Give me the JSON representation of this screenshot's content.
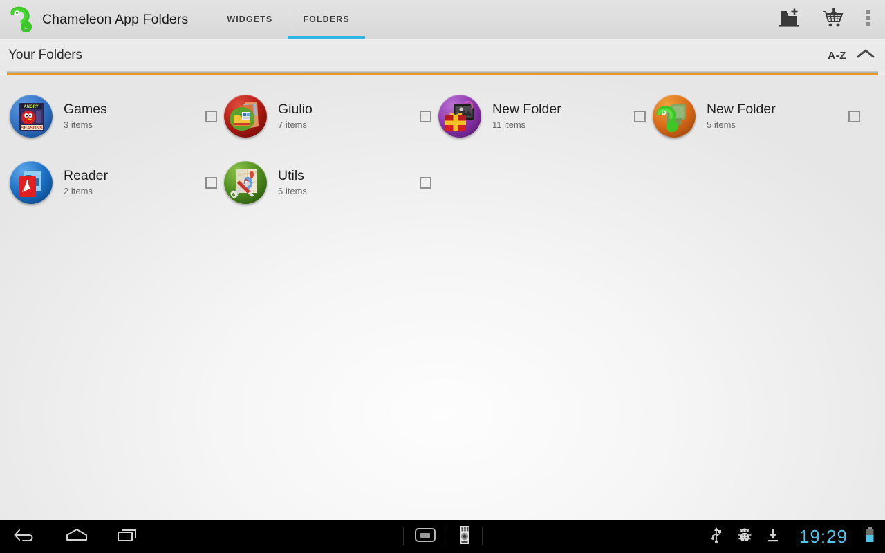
{
  "actionbar": {
    "logo_icon": "chameleon-logo-icon",
    "app_title": "Chameleon App Folders",
    "tabs": [
      {
        "label": "WIDGETS",
        "active": false
      },
      {
        "label": "FOLDERS",
        "active": true
      }
    ],
    "actions": [
      {
        "name": "new-folder-icon",
        "label": "New Folder"
      },
      {
        "name": "shopping-cart-download-icon",
        "label": "Get more"
      },
      {
        "name": "overflow-menu-icon",
        "label": "More options"
      }
    ],
    "accent_color": "#33b5e5"
  },
  "section": {
    "title": "Your Folders",
    "sort_label": "A-Z",
    "collapse_icon": "chevron-up-icon",
    "divider_color": "#e8871a"
  },
  "folders": [
    {
      "name": "Games",
      "count": "3 items",
      "icon": "angry-birds-seasons-icon",
      "bg": "#2f6fc0",
      "checked": false
    },
    {
      "name": "Giulio",
      "count": "7 items",
      "icon": "red-folder-stack-icon",
      "bg": "#b01a14",
      "checked": false
    },
    {
      "name": "New Folder",
      "count": "11 items",
      "icon": "purple-gift-box-icon",
      "bg": "#8b36ab",
      "checked": false
    },
    {
      "name": "New Folder",
      "count": "5 items",
      "icon": "chameleon-orange-icon",
      "bg": "#d96a18",
      "checked": false
    },
    {
      "name": "Reader",
      "count": "2 items",
      "icon": "adobe-reader-icon",
      "bg": "#1b6fc4",
      "checked": false
    },
    {
      "name": "Utils",
      "count": "6 items",
      "icon": "tools-map-icon",
      "bg": "#4e8a1e",
      "checked": false
    }
  ],
  "sysbar": {
    "back_icon": "back-arrow-icon",
    "home_icon": "home-icon",
    "recents_icon": "recent-apps-icon",
    "screenshot_icon": "screen-capture-icon",
    "remote_icon": "remote-control-icon",
    "usb_icon": "usb-icon",
    "adb_icon": "android-debug-icon",
    "download_icon": "download-icon",
    "clock": "19:29",
    "battery_icon": "battery-icon",
    "clock_color": "#4fc3e8"
  }
}
